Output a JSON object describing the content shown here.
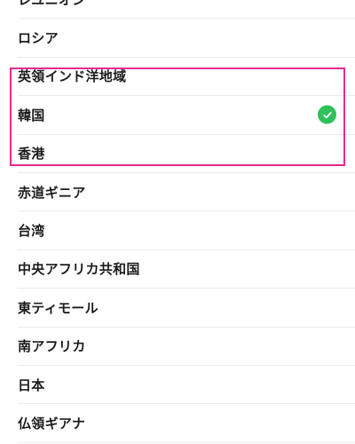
{
  "countries": [
    {
      "label": "レユニオン"
    },
    {
      "label": "ロシア"
    },
    {
      "label": "英領インド洋地域"
    },
    {
      "label": "韓国"
    },
    {
      "label": "香港"
    },
    {
      "label": "赤道ギニア"
    },
    {
      "label": "台湾"
    },
    {
      "label": "中央アフリカ共和国"
    },
    {
      "label": "東ティモール"
    },
    {
      "label": "南アフリカ"
    },
    {
      "label": "日本"
    },
    {
      "label": "仏領ギアナ"
    }
  ],
  "selected_index": 3,
  "colors": {
    "check": "#2ec15a",
    "highlight": "#e8288e",
    "text": "#1c1c1e",
    "divider": "#ebebeb"
  },
  "icons": {
    "selected": "checkmark-circle-icon"
  }
}
